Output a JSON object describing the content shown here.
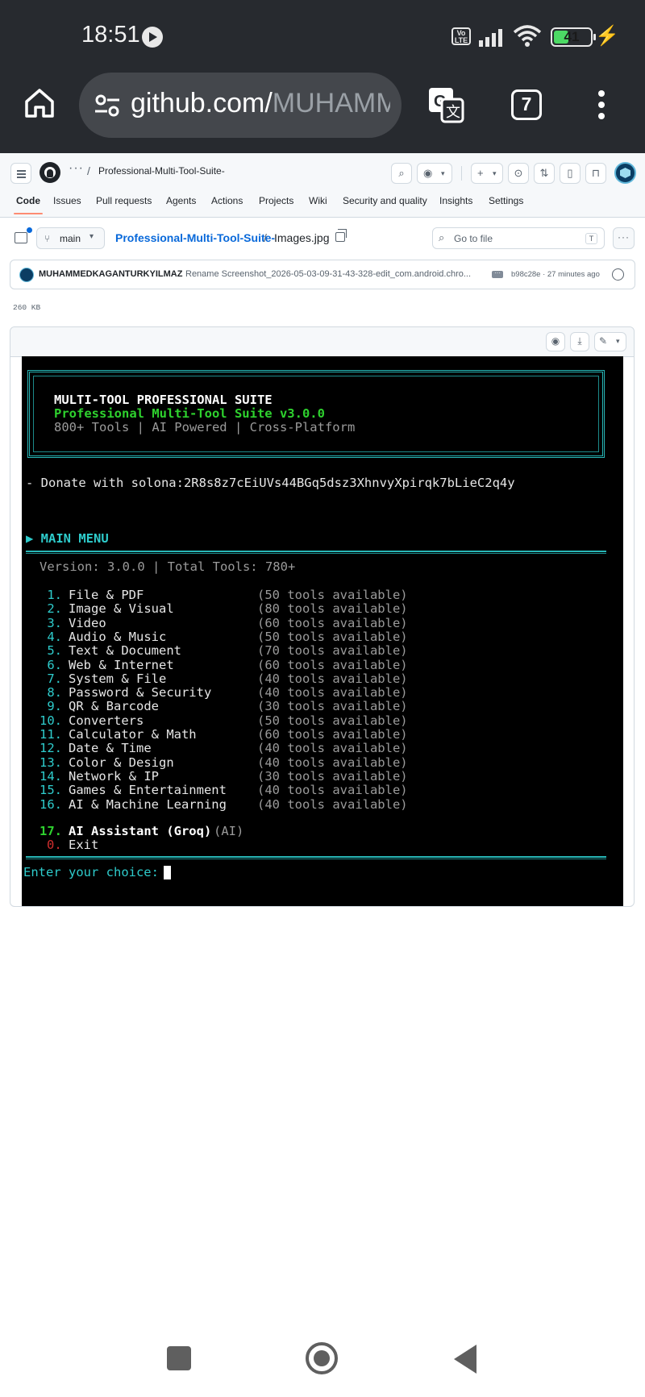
{
  "statusbar": {
    "time": "18:51",
    "volte": "Vo LTE",
    "battery": "41",
    "battery_level": 0.41
  },
  "browser": {
    "url_host": "github.com/",
    "url_path": "MUHAMM",
    "tab_count": "7"
  },
  "github": {
    "repo_name": "Professional-Multi-Tool-Suite-",
    "breadcrumb_dots": "···",
    "breadcrumb_slash": "/",
    "tabs": [
      "Code",
      "Issues",
      "Pull requests",
      "Agents",
      "Actions",
      "Projects",
      "Wiki",
      "Security and quality",
      "Insights",
      "Settings"
    ],
    "active_tab": "Code",
    "branch": "main",
    "path_repo": "Professional-Multi-Tool-Suite-",
    "path_sep": "/",
    "file_name": "Images.jpg",
    "goto_placeholder": "Go to file",
    "goto_key": "T",
    "commit": {
      "author": "MUHAMMEDKAGANTURKYILMAZ",
      "message": "Rename Screenshot_2026-05-03-09-31-43-328-edit_com.android.chro...",
      "hash_time": "b98c28e · 27 minutes ago"
    },
    "file_size": "260 KB",
    "accent": "#0969da",
    "active_tab_underline": "#fd8c73"
  },
  "terminal": {
    "banner_title": "MULTI-TOOL PROFESSIONAL SUITE",
    "banner_version": "Professional Multi-Tool Suite v3.0.0",
    "banner_tagline": "800+ Tools | AI Powered | Cross-Platform",
    "donate": "- Donate with solona:2R8s8z7cEiUVs44BGq5dsz3XhnvyXpirqk7bLieC2q4y",
    "menu_header": "▶ MAIN MENU",
    "version_line": "Version: 3.0.0 | Total Tools: 780+",
    "menu_items": [
      {
        "num": " 1.",
        "name": "File & PDF",
        "tools": "(50 tools available)"
      },
      {
        "num": " 2.",
        "name": "Image & Visual",
        "tools": "(80 tools available)"
      },
      {
        "num": " 3.",
        "name": "Video",
        "tools": "(60 tools available)"
      },
      {
        "num": " 4.",
        "name": "Audio & Music",
        "tools": "(50 tools available)"
      },
      {
        "num": " 5.",
        "name": "Text & Document",
        "tools": "(70 tools available)"
      },
      {
        "num": " 6.",
        "name": "Web & Internet",
        "tools": "(60 tools available)"
      },
      {
        "num": " 7.",
        "name": "System & File",
        "tools": "(40 tools available)"
      },
      {
        "num": " 8.",
        "name": "Password & Security",
        "tools": "(40 tools available)"
      },
      {
        "num": " 9.",
        "name": "QR & Barcode",
        "tools": "(30 tools available)"
      },
      {
        "num": "10.",
        "name": "Converters",
        "tools": "(50 tools available)"
      },
      {
        "num": "11.",
        "name": "Calculator & Math",
        "tools": "(60 tools available)"
      },
      {
        "num": "12.",
        "name": "Date & Time",
        "tools": "(40 tools available)"
      },
      {
        "num": "13.",
        "name": "Color & Design",
        "tools": "(40 tools available)"
      },
      {
        "num": "14.",
        "name": "Network & IP",
        "tools": "(30 tools available)"
      },
      {
        "num": "15.",
        "name": "Games & Entertainment",
        "tools": "(40 tools available)"
      },
      {
        "num": "16.",
        "name": "AI & Machine Learning",
        "tools": "(40 tools available)"
      }
    ],
    "ai_num": "17.",
    "ai_name": "AI Assistant (Groq)",
    "ai_tag": "(AI)",
    "exit_num": "0.",
    "exit_name": "Exit",
    "prompt": "Enter your choice:",
    "colors": {
      "cyan": "#2ecccc",
      "green": "#2ed12e",
      "red": "#d12e2e",
      "gray": "#9a9a9a"
    }
  }
}
